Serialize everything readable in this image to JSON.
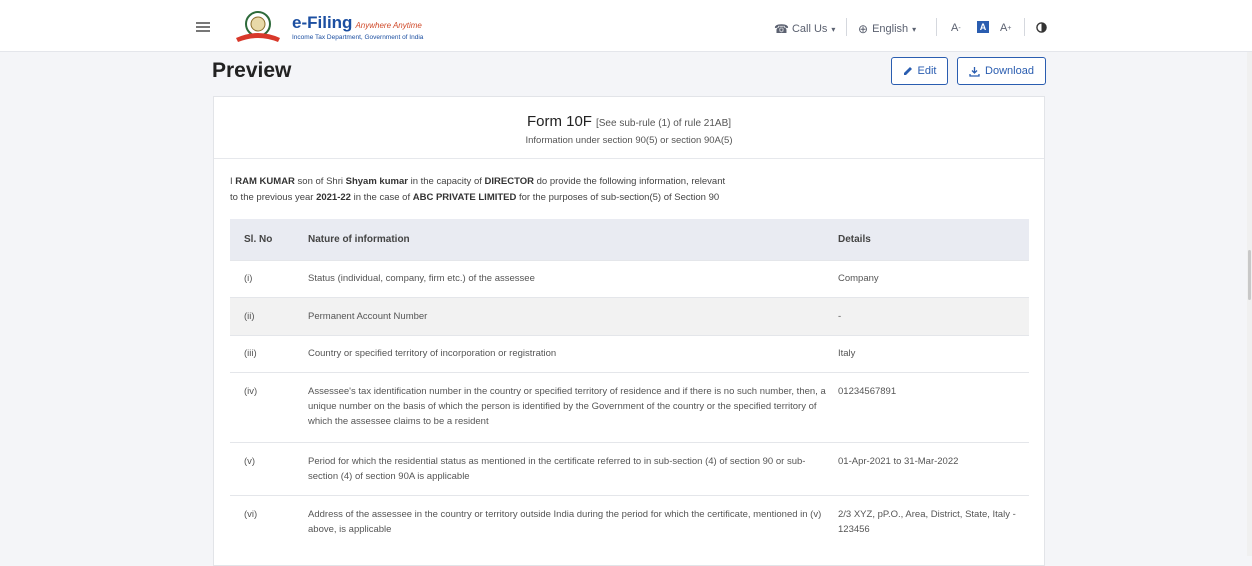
{
  "header": {
    "logo_main": "e-Filing",
    "logo_tag": "Anywhere Anytime",
    "logo_sub": "Income Tax Department, Government of India",
    "call_us": "Call Us",
    "language": "English",
    "font_decrease": "A",
    "font_normal": "A",
    "font_increase": "A"
  },
  "page": {
    "title": "Preview",
    "edit_label": "Edit",
    "download_label": "Download"
  },
  "form": {
    "title": "Form 10F",
    "rule": "[See sub-rule (1) of rule 21AB]",
    "subtitle": "Information under section 90(5) or section 90A(5)",
    "intro": {
      "p1": "I ",
      "name": "RAM KUMAR",
      "p2": " son of Shri ",
      "father": "Shyam kumar",
      "p3": " in the capacity of ",
      "capacity": "DIRECTOR",
      "p4": " do provide the following information, relevant",
      "p5": "to the previous year ",
      "year": "2021-22",
      "p6": " in the case of ",
      "company": "ABC PRIVATE LIMITED",
      "p7": " for the purposes of sub-section(5) of Section 90"
    },
    "columns": [
      "Sl. No",
      "Nature of information",
      "Details"
    ],
    "rows": [
      {
        "sl": "(i)",
        "nature": "Status (individual, company, firm etc.) of the assessee",
        "details": "Company"
      },
      {
        "sl": "(ii)",
        "nature": "Permanent Account Number",
        "details": "-"
      },
      {
        "sl": "(iii)",
        "nature": "Country or specified territory of incorporation or registration",
        "details": "Italy"
      },
      {
        "sl": "(iv)",
        "nature": "Assessee's tax identification number in the country or specified territory of residence and if there is no such number, then, a unique number on the basis of which the person is identified by the Government of the country or the specified territory of which the assessee claims to be a resident",
        "details": "01234567891"
      },
      {
        "sl": "(v)",
        "nature": "Period for which the residential status as mentioned in the certificate referred to in sub-section (4) of section 90 or sub-section (4) of section 90A is applicable",
        "details": "01-Apr-2021  to  31-Mar-2022"
      },
      {
        "sl": "(vi)",
        "nature": "Address of the assessee in the country or territory outside India during the period for which the certificate, mentioned in (v) above, is applicable",
        "details": "2/3 XYZ, pP.O., Area, District, State, Italy - 123456"
      }
    ]
  },
  "colors": {
    "accent": "#2a5db0",
    "header_bg": "#e9ebf2",
    "shade": "#f2f2f2"
  }
}
